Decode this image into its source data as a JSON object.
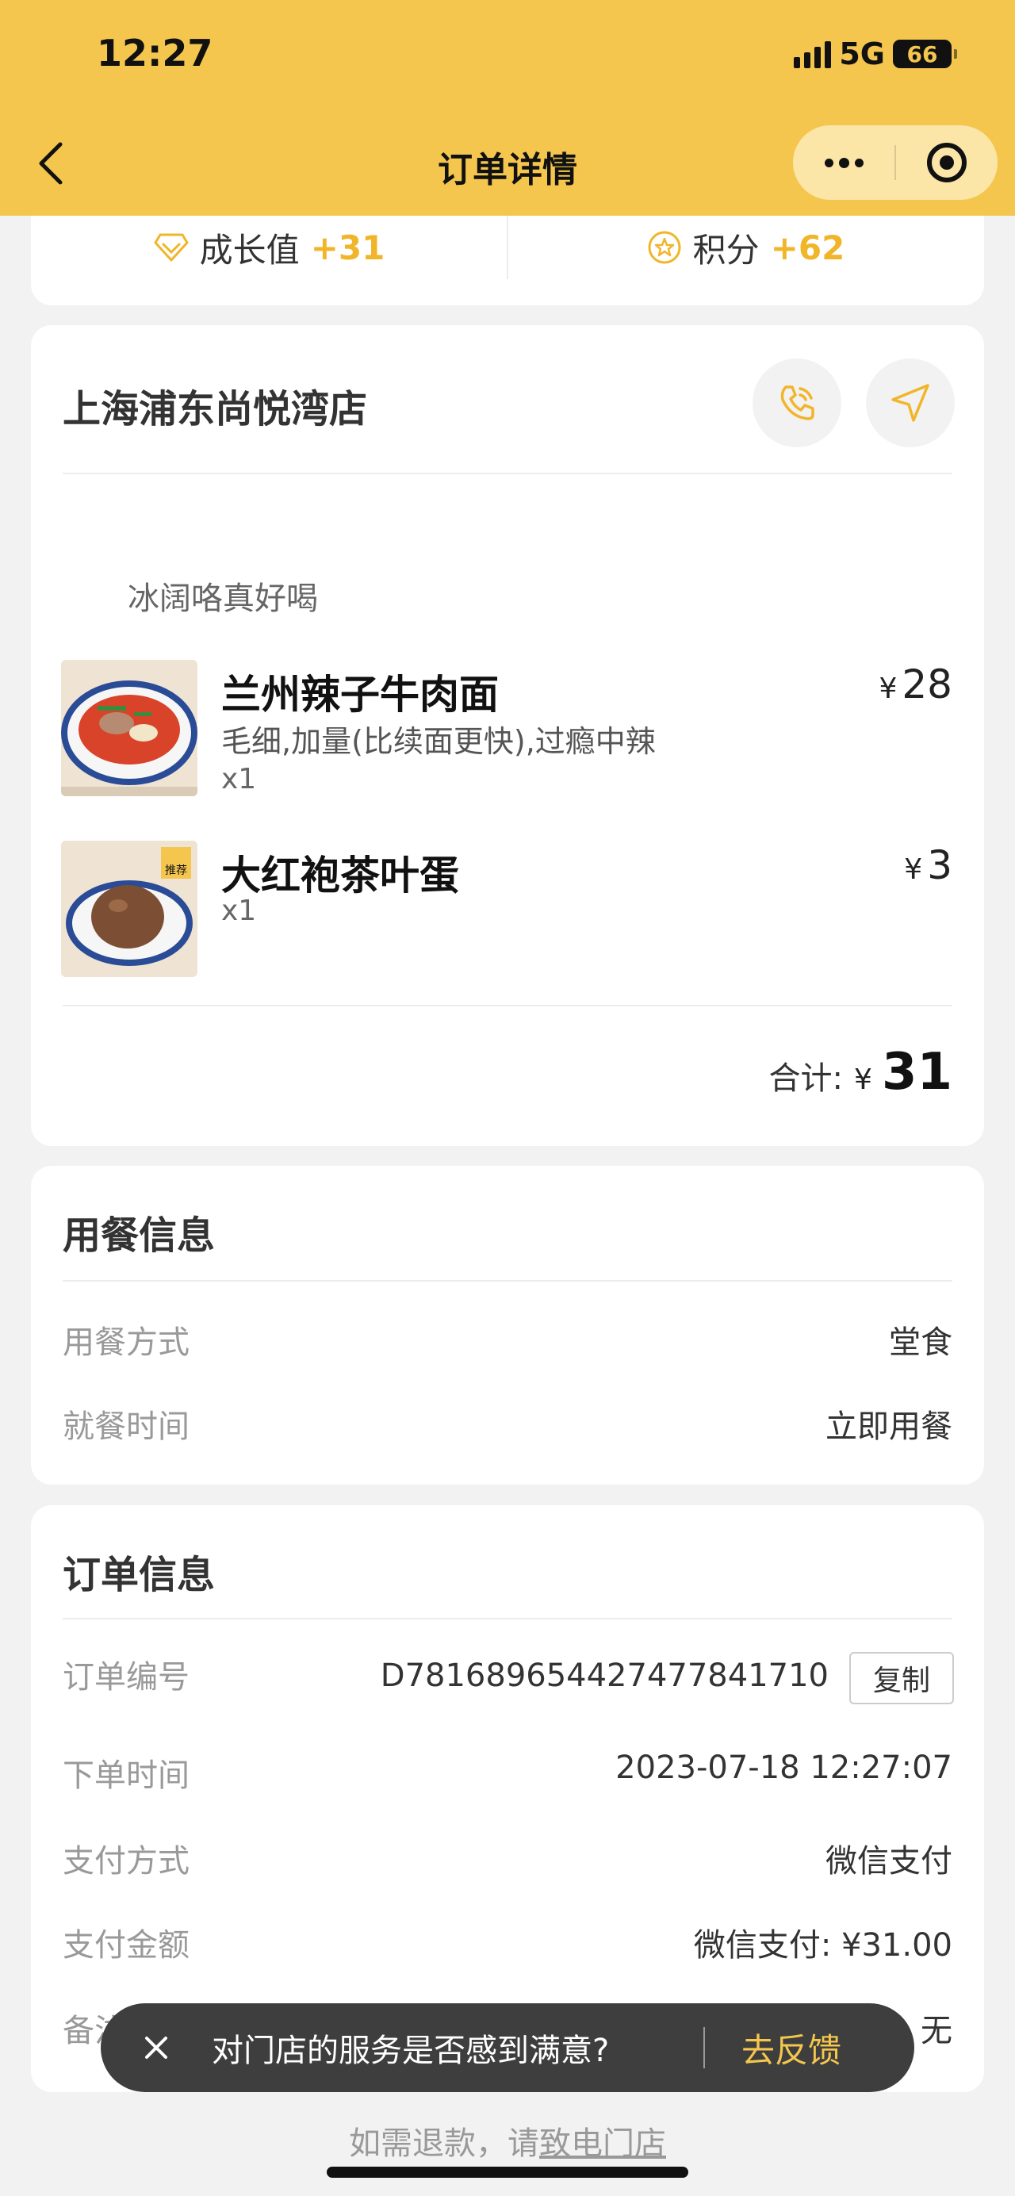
{
  "status_bar": {
    "time": "12:27",
    "network": "5G",
    "battery": "66"
  },
  "nav": {
    "title": "订单详情"
  },
  "rewards": {
    "growth_label": "成长值",
    "growth_value": "+31",
    "points_label": "积分",
    "points_value": "+62"
  },
  "store": {
    "name": "上海浦东尚悦湾店"
  },
  "order_note": "冰阔咯真好喝",
  "items": [
    {
      "name": "兰州辣子牛肉面",
      "spec": "毛细,加量(比续面更快),过瘾中辣",
      "qty": "x1",
      "currency": "¥",
      "price": "28"
    },
    {
      "name": "大红袍茶叶蛋",
      "qty": "x1",
      "currency": "¥",
      "price": "3",
      "badge": "推荐"
    }
  ],
  "total": {
    "label": "合计:",
    "currency": "¥",
    "amount": "31"
  },
  "dining": {
    "title": "用餐信息",
    "rows": [
      {
        "label": "用餐方式",
        "value": "堂食"
      },
      {
        "label": "就餐时间",
        "value": "立即用餐"
      }
    ]
  },
  "order": {
    "title": "订单信息",
    "number_label": "订单编号",
    "number": "D781689654427477841710",
    "copy_label": "复制",
    "time_label": "下单时间",
    "time": "2023-07-18 12:27:07",
    "pay_method_label": "支付方式",
    "pay_method": "微信支付",
    "pay_amount_label": "支付金额",
    "pay_amount": "微信支付: ¥31.00",
    "remark_label": "备注信息",
    "remark": "无"
  },
  "toast": {
    "text": "对门店的服务是否感到满意?",
    "action": "去反馈"
  },
  "footer": {
    "refund_text": "如需退款，请",
    "refund_link": "致电门店"
  },
  "colors": {
    "brand_yellow": "#f4c64e",
    "accent_orange": "#f1b52a"
  }
}
